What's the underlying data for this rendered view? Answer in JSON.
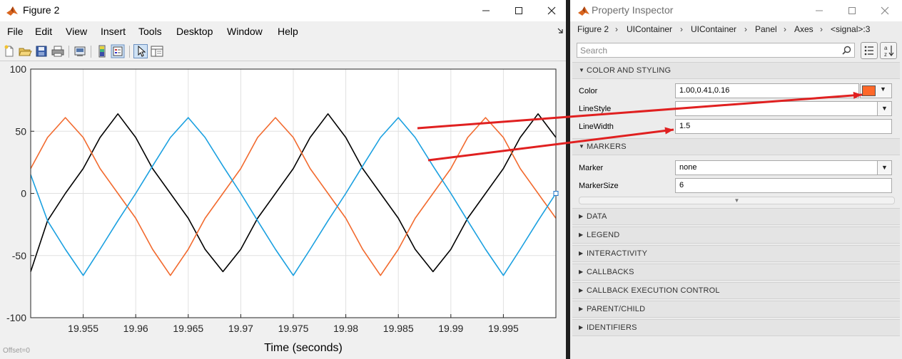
{
  "figure": {
    "title": "Figure 2",
    "menu": [
      "File",
      "Edit",
      "View",
      "Insert",
      "Tools",
      "Desktop",
      "Window",
      "Help"
    ],
    "toolbar_icons": [
      "new-figure-icon",
      "open-file-icon",
      "save-icon",
      "print-icon",
      "link-icon",
      "colorbar-icon",
      "legend-icon",
      "pointer-icon",
      "property-editor-icon"
    ],
    "offset_text": "Offset=0",
    "selection_marker_text": ""
  },
  "chart_data": {
    "type": "line",
    "xlabel": "Time (seconds)",
    "ylabel": "",
    "title": "",
    "xlim": [
      19.95,
      20.0
    ],
    "ylim": [
      -100,
      100
    ],
    "xticks": [
      "19.955",
      "19.96",
      "19.965",
      "19.97",
      "19.975",
      "19.98",
      "19.985",
      "19.99",
      "19.995"
    ],
    "yticks": [
      "100",
      "50",
      "0",
      "-50",
      "-100"
    ],
    "grid": true,
    "series": [
      {
        "color": "#000000",
        "x": [
          19.95,
          19.9516,
          19.9533,
          19.955,
          19.9566,
          19.9583,
          19.96,
          19.9616,
          19.9633,
          19.965,
          19.9666,
          19.9683,
          19.97,
          19.9716,
          19.9733,
          19.975,
          19.9766,
          19.9783,
          19.98,
          19.9816,
          19.9833,
          19.985,
          19.9866,
          19.9883,
          19.99,
          19.9916,
          19.9933,
          19.995,
          19.9966,
          19.9983,
          20.0
        ],
        "y": [
          -63,
          -22,
          0,
          20,
          45,
          64,
          45,
          20,
          0,
          -20,
          -45,
          -63,
          -45,
          -20,
          0,
          20,
          45,
          64,
          45,
          20,
          0,
          -20,
          -45,
          -63,
          -45,
          -20,
          0,
          20,
          45,
          64,
          45
        ]
      },
      {
        "color": "#f26a2e",
        "x": [
          19.95,
          19.9516,
          19.9533,
          19.955,
          19.9566,
          19.9583,
          19.96,
          19.9616,
          19.9633,
          19.965,
          19.9666,
          19.9683,
          19.97,
          19.9716,
          19.9733,
          19.975,
          19.9766,
          19.9783,
          19.98,
          19.9816,
          19.9833,
          19.985,
          19.9866,
          19.9883,
          19.99,
          19.9916,
          19.9933,
          19.995,
          19.9966,
          19.9983,
          20.0
        ],
        "y": [
          20,
          45,
          61,
          45,
          20,
          0,
          -20,
          -45,
          -66,
          -45,
          -20,
          0,
          20,
          45,
          61,
          45,
          20,
          0,
          -20,
          -45,
          -66,
          -45,
          -20,
          0,
          20,
          45,
          61,
          45,
          20,
          0,
          -20
        ]
      },
      {
        "color": "#1aa0e0",
        "x": [
          19.95,
          19.9516,
          19.9533,
          19.955,
          19.9566,
          19.9583,
          19.96,
          19.9616,
          19.9633,
          19.965,
          19.9666,
          19.9683,
          19.97,
          19.9716,
          19.9733,
          19.975,
          19.9766,
          19.9783,
          19.98,
          19.9816,
          19.9833,
          19.985,
          19.9866,
          19.9883,
          19.99,
          19.9916,
          19.9933,
          19.995,
          19.9966,
          19.9983,
          20.0
        ],
        "y": [
          15,
          -22,
          -45,
          -66,
          -45,
          -22,
          0,
          22,
          45,
          61,
          45,
          22,
          0,
          -22,
          -45,
          -66,
          -45,
          -22,
          0,
          22,
          45,
          61,
          45,
          22,
          0,
          -22,
          -45,
          -66,
          -45,
          -22,
          0
        ]
      }
    ]
  },
  "inspector": {
    "title": "Property Inspector",
    "breadcrumbs": [
      "Figure 2",
      "UIContainer",
      "UIContainer",
      "Panel",
      "Axes",
      "<signal>:3"
    ],
    "search_placeholder": "Search",
    "sections": {
      "color_styling": "COLOR AND STYLING",
      "markers": "MARKERS",
      "collapsed": [
        "DATA",
        "LEGEND",
        "INTERACTIVITY",
        "CALLBACKS",
        "CALLBACK EXECUTION CONTROL",
        "PARENT/CHILD",
        "IDENTIFIERS"
      ]
    },
    "props": {
      "color_label": "Color",
      "color_value": "1.00,0.41,0.16",
      "color_swatch": "#ff6829",
      "linestyle_label": "LineStyle",
      "linestyle_value": "",
      "linewidth_label": "LineWidth",
      "linewidth_value": "1.5",
      "marker_label": "Marker",
      "marker_value": "none",
      "markersize_label": "MarkerSize",
      "markersize_value": "6"
    }
  },
  "annotation_color": "#e02020"
}
